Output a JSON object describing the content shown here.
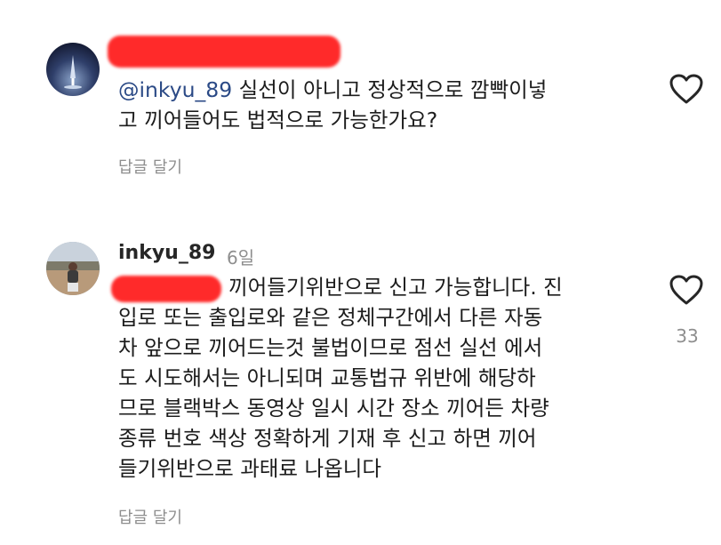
{
  "comments": [
    {
      "username": "",
      "mention": "@inkyu_89",
      "text": " 실선이 아니고 정상적으로 깜빡이넣\n고 끼어들어도 법적으로 가능한가요?",
      "reply_label": "답글 달기",
      "likes": ""
    },
    {
      "username": "inkyu_89",
      "timestamp": "6일",
      "text_first_line": "끼어들기위반으로 신고 가능합니다. 진",
      "text_rest": "입로 또는 출입로와 같은 정체구간에서 다른 자동\n차 앞으로 끼어드는것 불법이므로 점선 실선 에서\n도 시도해서는 아니되며 교통법규 위반에 해당하\n므로 블랙박스 동영상 일시 시간 장소 끼어든 차량\n종류 번호 색상 정확하게 기재 후 신고 하면 끼어\n들기위반으로 과태료 나옵니다",
      "reply_label": "답글 달기",
      "likes": "33"
    }
  ],
  "icons": {
    "like": "heart-outline-icon"
  },
  "colors": {
    "redaction": "#ff2a2a",
    "mention": "#2b4a86",
    "secondary_text": "#8e8e8e"
  }
}
